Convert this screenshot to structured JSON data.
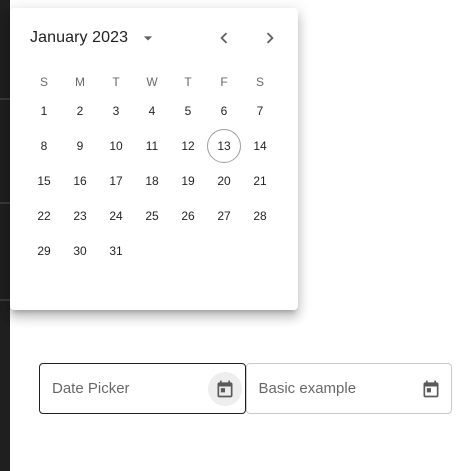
{
  "calendar": {
    "month_label": "January 2023",
    "weekdays": [
      "S",
      "M",
      "T",
      "W",
      "T",
      "F",
      "S"
    ],
    "start_offset": 0,
    "days": [
      "1",
      "2",
      "3",
      "4",
      "5",
      "6",
      "7",
      "8",
      "9",
      "10",
      "11",
      "12",
      "13",
      "14",
      "15",
      "16",
      "17",
      "18",
      "19",
      "20",
      "21",
      "22",
      "23",
      "24",
      "25",
      "26",
      "27",
      "28",
      "29",
      "30",
      "31"
    ],
    "today": "13"
  },
  "fields": {
    "date_picker": {
      "label": "Date Picker"
    },
    "basic_example": {
      "label": "Basic example"
    }
  },
  "icons": {
    "dropdown": "arrow-drop-down-icon",
    "prev": "chevron-left-icon",
    "next": "chevron-right-icon",
    "calendar": "calendar-icon"
  }
}
